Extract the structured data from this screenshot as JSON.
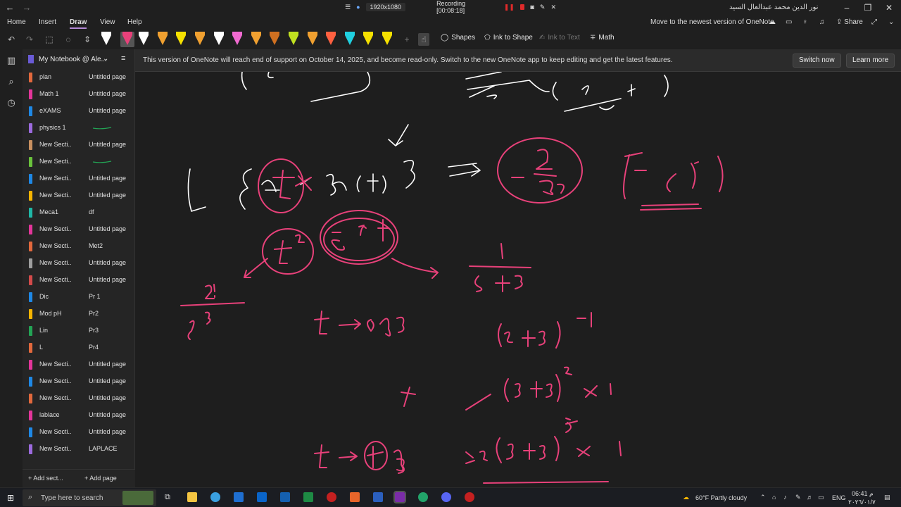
{
  "titlebar": {
    "back_icon": "back-arrow-icon",
    "forward_icon": "forward-arrow-icon",
    "recording": {
      "resolution": "1920x1080",
      "label": "Recording [00:08:18]"
    },
    "user_name": "نور الدين محمد عبدالعال السيد",
    "window_controls": [
      "minimize",
      "restore",
      "close"
    ]
  },
  "menu": {
    "items": [
      "Home",
      "Insert",
      "Draw",
      "View",
      "Help"
    ],
    "active": "Draw",
    "newest_version": "Move to the newest version of OneNote",
    "share": "Share"
  },
  "ribbon": {
    "pen_colors": [
      "#ffffff",
      "#e8417a",
      "#ffffff",
      "#f0a030",
      "#f5e000",
      "#f0a030",
      "#ffffff",
      "#f06ad0",
      "#f0a030",
      "#d07020",
      "#c0e020",
      "#f0a030",
      "#ff6040",
      "#20d0e0",
      "#f5e000",
      "#f5e000"
    ],
    "shapes": "Shapes",
    "ink_to_shape": "Ink to Shape",
    "ink_to_text": "Ink to Text",
    "math": "Math"
  },
  "notebook": {
    "title": "My Notebook @ Ale...",
    "sections": [
      {
        "label": "plan",
        "color": "#e2683c"
      },
      {
        "label": "Math 1",
        "color": "#e3359a"
      },
      {
        "label": "eXAMS",
        "color": "#1e88e5"
      },
      {
        "label": "physics 1",
        "color": "#9c6ade"
      },
      {
        "label": "New Secti...",
        "color": "#c89060"
      },
      {
        "label": "New Secti...",
        "color": "#6ac23c"
      },
      {
        "label": "New Secti...",
        "color": "#1e88e5"
      },
      {
        "label": "New Secti...",
        "color": "#f5b400"
      },
      {
        "label": "Meca1",
        "color": "#1fb7a6"
      },
      {
        "label": "New Secti...",
        "color": "#e3359a"
      },
      {
        "label": "New Secti...",
        "color": "#e2683c"
      },
      {
        "label": "New Secti...",
        "color": "#9e9e9e"
      },
      {
        "label": "New Secti...",
        "color": "#d34a4a"
      },
      {
        "label": "Dic",
        "color": "#1e88e5"
      },
      {
        "label": "Mod pH",
        "color": "#f5b400"
      },
      {
        "label": "Lin",
        "color": "#23a455"
      },
      {
        "label": "L",
        "color": "#e2683c"
      },
      {
        "label": "New Secti...",
        "color": "#e3359a"
      },
      {
        "label": "New Secti...",
        "color": "#1e88e5"
      },
      {
        "label": "New Secti...",
        "color": "#e2683c"
      },
      {
        "label": "lablace",
        "color": "#e3359a"
      },
      {
        "label": "New Secti...",
        "color": "#1e88e5"
      },
      {
        "label": "New Secti...",
        "color": "#9c6ade"
      }
    ],
    "pages": [
      "Untitled page",
      "Untitled page",
      "Untitled page",
      "",
      "Untitled page",
      "",
      "Untitled page",
      "Untitled page",
      "df",
      "Untitled page",
      "Met2",
      "Untitled page",
      "Untitled page",
      "Pr 1",
      "Pr2",
      "Pr3",
      "Pr4",
      "Untitled page",
      "Untitled page",
      "Untitled page",
      "Untitled page",
      "Untitled page",
      "LAPLACE"
    ],
    "add_section": "Add sect...",
    "add_page": "Add page"
  },
  "banner": {
    "message": "This version of OneNote will reach end of support on October 14, 2025, and become read-only. Switch to the new OneNote app to keep editing and get the latest features.",
    "switch_now": "Switch now",
    "learn_more": "Learn more"
  },
  "taskbar": {
    "search_placeholder": "Type here to search",
    "weather": "60°F  Partly cloudy",
    "language": "ENG",
    "time": "06:41 م",
    "date": "٢٠٢٦/٠١/٧"
  }
}
